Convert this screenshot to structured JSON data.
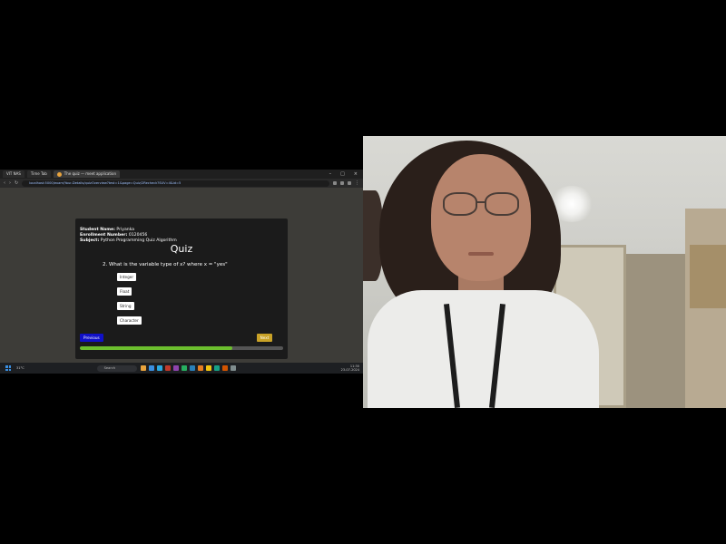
{
  "browser": {
    "tabs": [
      {
        "label": "VIT NAS"
      },
      {
        "label": "Time Tab"
      },
      {
        "label": "The quiz — meet application"
      }
    ],
    "url": "localhost:5000/exam/Your-Details/quizOverview?test=1&page=Quiz/2Recheck?SUV=4&id=5",
    "window_controls": [
      "–",
      "□",
      "×"
    ]
  },
  "quiz": {
    "student_name_label": "Student Name:",
    "student_name_value": "Priyanka",
    "enrollment_label": "Enrollment Number:",
    "enrollment_value": "0120456",
    "subject_label": "Subject:",
    "subject_value": "Python Programming Quiz Algorithm",
    "title": "Quiz",
    "question": "2. What is the variable type of x? where x = \"yes\"",
    "options": [
      "Integer",
      "Float",
      "String",
      "Character"
    ],
    "previous_label": "Previous",
    "next_label": "Next",
    "progress": 0.75
  },
  "taskbar": {
    "weather": "31°C",
    "search_placeholder": "Search",
    "time": "11:30",
    "date": "23-07-2024",
    "icon_colors": [
      "#e8a33d",
      "#3a8fe0",
      "#2aa9e0",
      "#c0392b",
      "#8e44ad",
      "#27ae60",
      "#2980b9",
      "#e67e22",
      "#f1c40f",
      "#16a085",
      "#d35400",
      "#7f8c8d"
    ]
  }
}
